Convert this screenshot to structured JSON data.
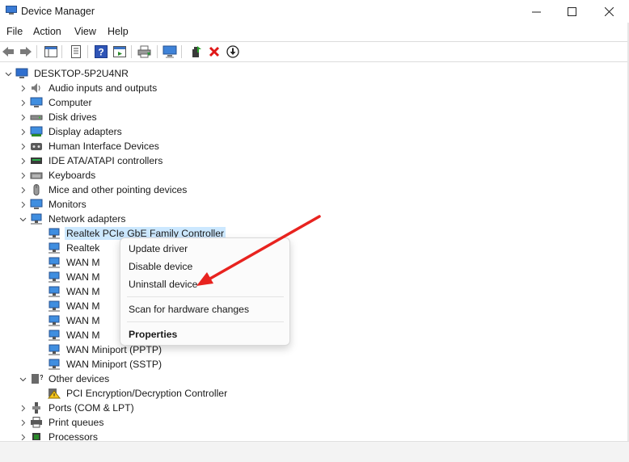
{
  "window": {
    "title": "Device Manager"
  },
  "menu": [
    "File",
    "Action",
    "View",
    "Help"
  ],
  "tree": {
    "root": "DESKTOP-5P2U4NR",
    "categories": [
      "Audio inputs and outputs",
      "Computer",
      "Disk drives",
      "Display adapters",
      "Human Interface Devices",
      "IDE ATA/ATAPI controllers",
      "Keyboards",
      "Mice and other pointing devices",
      "Monitors",
      "Network adapters"
    ],
    "network_children": [
      "Realtek PCIe GbE Family Controller",
      "Realtek",
      "WAN M",
      "WAN M",
      "WAN M",
      "WAN M",
      "WAN M",
      "WAN M",
      "WAN Miniport (PPTP)",
      "WAN Miniport (SSTP)"
    ],
    "other_devices": "Other devices",
    "other_children": [
      "PCI Encryption/Decryption Controller"
    ],
    "more": [
      "Ports (COM & LPT)",
      "Print queues",
      "Processors"
    ]
  },
  "context_menu": {
    "update": "Update driver",
    "disable": "Disable device",
    "uninstall": "Uninstall device",
    "scan": "Scan for hardware changes",
    "properties": "Properties"
  },
  "colors": {
    "selection": "#cce8ff",
    "arrow": "#e8231f",
    "delete_icon": "#e01818"
  }
}
